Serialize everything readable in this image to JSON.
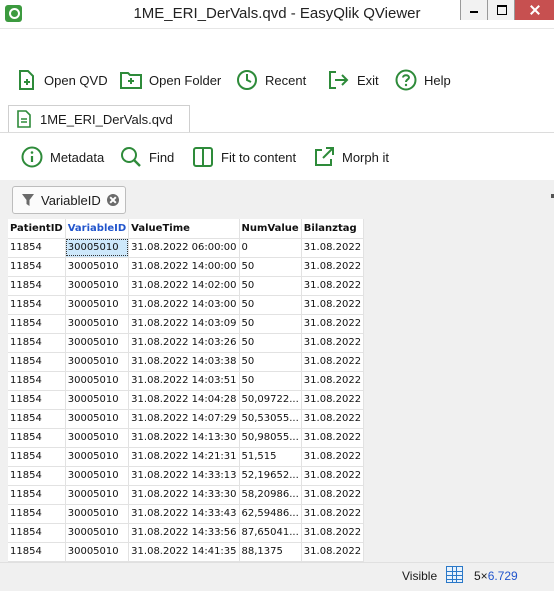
{
  "window": {
    "title": "1ME_ERI_DerVals.qvd - EasyQlik QViewer"
  },
  "toolbar": {
    "open_qvd": "Open QVD",
    "open_folder": "Open Folder",
    "recent": "Recent",
    "exit": "Exit",
    "help": "Help"
  },
  "document_tab": {
    "label": "1ME_ERI_DerVals.qvd"
  },
  "subtoolbar": {
    "metadata": "Metadata",
    "find": "Find",
    "fit_to_content": "Fit to content",
    "morph_it": "Morph it"
  },
  "filter": {
    "chip_label": "VariableID"
  },
  "icons": {
    "accent": "#2e8b3a",
    "link": "#2255cc"
  },
  "grid": {
    "columns": [
      "PatientID",
      "VariableID",
      "ValueTime",
      "NumValue",
      "Bilanztag"
    ],
    "active_column": "VariableID",
    "rows": [
      [
        "11854",
        "30005010",
        "31.08.2022 06:00:00",
        "0",
        "31.08.2022"
      ],
      [
        "11854",
        "30005010",
        "31.08.2022 14:00:00",
        "50",
        "31.08.2022"
      ],
      [
        "11854",
        "30005010",
        "31.08.2022 14:02:00",
        "50",
        "31.08.2022"
      ],
      [
        "11854",
        "30005010",
        "31.08.2022 14:03:00",
        "50",
        "31.08.2022"
      ],
      [
        "11854",
        "30005010",
        "31.08.2022 14:03:09",
        "50",
        "31.08.2022"
      ],
      [
        "11854",
        "30005010",
        "31.08.2022 14:03:26",
        "50",
        "31.08.2022"
      ],
      [
        "11854",
        "30005010",
        "31.08.2022 14:03:38",
        "50",
        "31.08.2022"
      ],
      [
        "11854",
        "30005010",
        "31.08.2022 14:03:51",
        "50",
        "31.08.2022"
      ],
      [
        "11854",
        "30005010",
        "31.08.2022 14:04:28",
        "50,09722...",
        "31.08.2022"
      ],
      [
        "11854",
        "30005010",
        "31.08.2022 14:07:29",
        "50,53055...",
        "31.08.2022"
      ],
      [
        "11854",
        "30005010",
        "31.08.2022 14:13:30",
        "50,98055...",
        "31.08.2022"
      ],
      [
        "11854",
        "30005010",
        "31.08.2022 14:21:31",
        "51,515",
        "31.08.2022"
      ],
      [
        "11854",
        "30005010",
        "31.08.2022 14:33:13",
        "52,19652...",
        "31.08.2022"
      ],
      [
        "11854",
        "30005010",
        "31.08.2022 14:33:30",
        "58,20986...",
        "31.08.2022"
      ],
      [
        "11854",
        "30005010",
        "31.08.2022 14:33:43",
        "62,59486...",
        "31.08.2022"
      ],
      [
        "11854",
        "30005010",
        "31.08.2022 14:33:56",
        "87,65041...",
        "31.08.2022"
      ],
      [
        "11854",
        "30005010",
        "31.08.2022 14:41:35",
        "88,1375",
        "31.08.2022"
      ]
    ]
  },
  "status": {
    "label": "Visible",
    "size_prefix": "5×",
    "size_rows": "6.729"
  }
}
